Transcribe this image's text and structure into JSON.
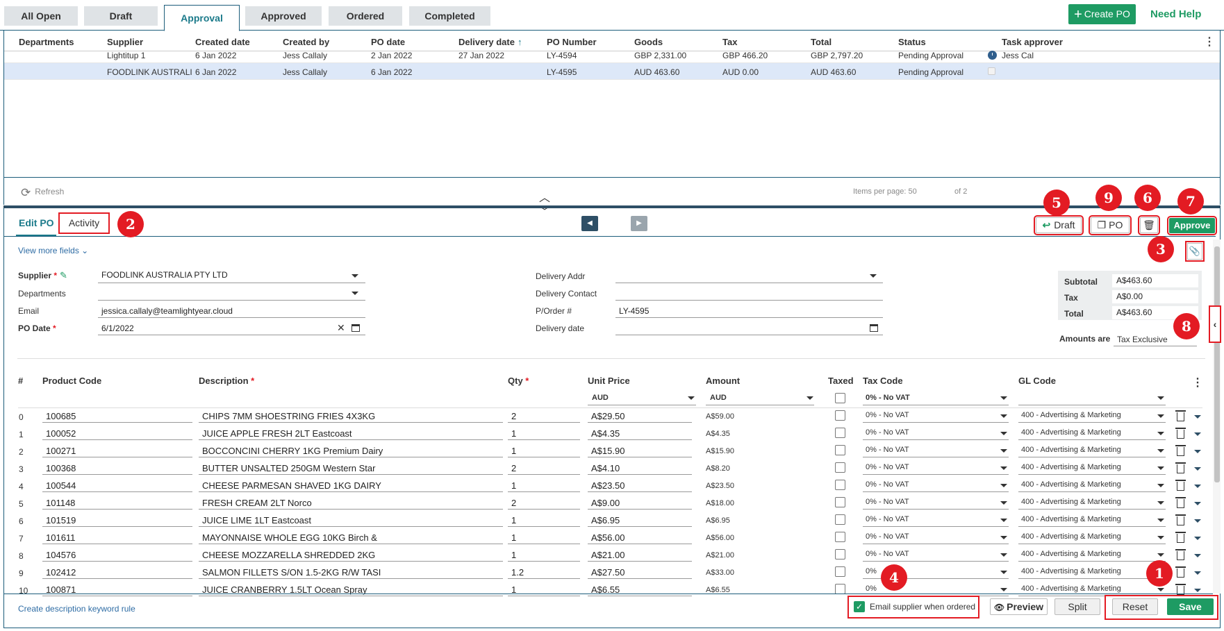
{
  "tabs": [
    "All Open",
    "Draft",
    "Approval",
    "Approved",
    "Ordered",
    "Completed"
  ],
  "header": {
    "create_po": "Create PO",
    "need_help": "Need Help"
  },
  "grid": {
    "columns": [
      "Departments",
      "Supplier",
      "Created date",
      "Created by",
      "PO date",
      "Delivery date",
      "PO Number",
      "Goods",
      "Tax",
      "Total",
      "Status",
      "Task approver"
    ],
    "sort_indicator": "↑",
    "rows": [
      {
        "department": "",
        "supplier": "Lightitup 1",
        "created": "6 Jan 2022",
        "created_by": "Jess Callaly",
        "po_date": "2 Jan 2022",
        "delivery": "27 Jan 2022",
        "po_number": "LY-4594",
        "goods": "GBP 2,331.00",
        "tax": "GBP 466.20",
        "total": "GBP 2,797.20",
        "status": "Pending Approval",
        "approver": "Jess Cal"
      },
      {
        "department": "",
        "supplier": "FOODLINK AUSTRALIA ...",
        "created": "6 Jan 2022",
        "created_by": "Jess Callaly",
        "po_date": "6 Jan 2022",
        "delivery": "",
        "po_number": "LY-4595",
        "goods": "AUD 463.60",
        "tax": "AUD 0.00",
        "total": "AUD 463.60",
        "status": "Pending Approval",
        "approver": ""
      }
    ],
    "refresh": "Refresh",
    "items_per_page": "Items per page: 50",
    "pager_text": "of 2"
  },
  "edit": {
    "tab_edit": "Edit PO",
    "tab_activity": "Activity",
    "btn_draft": "Draft",
    "btn_po": "PO",
    "btn_approve": "Approve",
    "view_more": "View more fields",
    "labels": {
      "supplier": "Supplier",
      "departments": "Departments",
      "email": "Email",
      "po_date": "PO Date",
      "delivery_addr": "Delivery Addr",
      "delivery_contact": "Delivery Contact",
      "porder": "P/Order #",
      "delivery_date": "Delivery date"
    },
    "values": {
      "supplier": "FOODLINK AUSTRALIA PTY LTD",
      "departments": "",
      "email": "jessica.callaly@teamlightyear.cloud",
      "po_date": "6/1/2022",
      "delivery_addr": "",
      "delivery_contact": "",
      "porder": "LY-4595",
      "delivery_date": ""
    },
    "totals": {
      "subtotal_label": "Subtotal",
      "subtotal": "A$463.60",
      "tax_label": "Tax",
      "tax": "A$0.00",
      "total_label": "Total",
      "total": "A$463.60",
      "amounts_label": "Amounts are",
      "amounts": "Tax Exclusive"
    }
  },
  "lines": {
    "columns": [
      "#",
      "Product Code",
      "Description",
      "Qty",
      "Unit Price",
      "Amount",
      "Taxed",
      "Tax Code",
      "GL Code"
    ],
    "unit_currency": "AUD",
    "amount_currency": "AUD",
    "default_tax": "0% - No VAT",
    "rows": [
      {
        "n": "0",
        "code": "100685",
        "desc": "CHIPS 7MM SHOESTRING FRIES 4X3KG",
        "qty": "2",
        "price": "A$29.50",
        "amount": "A$59.00",
        "tax": "0% - No VAT",
        "gl": "400 - Advertising & Marketing"
      },
      {
        "n": "1",
        "code": "100052",
        "desc": "JUICE APPLE FRESH 2LT Eastcoast",
        "qty": "1",
        "price": "A$4.35",
        "amount": "A$4.35",
        "tax": "0% - No VAT",
        "gl": "400 - Advertising & Marketing"
      },
      {
        "n": "2",
        "code": "100271",
        "desc": "BOCCONCINI CHERRY 1KG Premium Dairy",
        "qty": "1",
        "price": "A$15.90",
        "amount": "A$15.90",
        "tax": "0% - No VAT",
        "gl": "400 - Advertising & Marketing"
      },
      {
        "n": "3",
        "code": "100368",
        "desc": "BUTTER UNSALTED 250GM Western Star",
        "qty": "2",
        "price": "A$4.10",
        "amount": "A$8.20",
        "tax": "0% - No VAT",
        "gl": "400 - Advertising & Marketing"
      },
      {
        "n": "4",
        "code": "100544",
        "desc": "CHEESE PARMESAN SHAVED 1KG DAIRY",
        "qty": "1",
        "price": "A$23.50",
        "amount": "A$23.50",
        "tax": "0% - No VAT",
        "gl": "400 - Advertising & Marketing"
      },
      {
        "n": "5",
        "code": "101148",
        "desc": "FRESH CREAM 2LT Norco",
        "qty": "2",
        "price": "A$9.00",
        "amount": "A$18.00",
        "tax": "0% - No VAT",
        "gl": "400 - Advertising & Marketing"
      },
      {
        "n": "6",
        "code": "101519",
        "desc": "JUICE LIME 1LT Eastcoast",
        "qty": "1",
        "price": "A$6.95",
        "amount": "A$6.95",
        "tax": "0% - No VAT",
        "gl": "400 - Advertising & Marketing"
      },
      {
        "n": "7",
        "code": "101611",
        "desc": "MAYONNAISE WHOLE EGG 10KG Birch &",
        "qty": "1",
        "price": "A$56.00",
        "amount": "A$56.00",
        "tax": "0% - No VAT",
        "gl": "400 - Advertising & Marketing"
      },
      {
        "n": "8",
        "code": "104576",
        "desc": "CHEESE MOZZARELLA SHREDDED 2KG",
        "qty": "1",
        "price": "A$21.00",
        "amount": "A$21.00",
        "tax": "0% - No VAT",
        "gl": "400 - Advertising & Marketing"
      },
      {
        "n": "9",
        "code": "102412",
        "desc": "SALMON FILLETS S/ON 1.5-2KG R/W TASI",
        "qty": "1.2",
        "price": "A$27.50",
        "amount": "A$33.00",
        "tax": "0%",
        "gl": "400 - Advertising & Marketing"
      },
      {
        "n": "10",
        "code": "100871",
        "desc": "JUICE CRANBERRY 1.5LT Ocean Spray",
        "qty": "1",
        "price": "A$6.55",
        "amount": "A$6.55",
        "tax": "0%",
        "gl": "400 - Advertising & Marketing"
      }
    ]
  },
  "footer": {
    "keyword_rule": "Create description keyword rule",
    "email_supplier": "Email supplier when ordered",
    "preview": "Preview",
    "split": "Split",
    "reset": "Reset",
    "save": "Save"
  },
  "annotations": [
    "1",
    "2",
    "3",
    "4",
    "5",
    "6",
    "7",
    "8",
    "9"
  ],
  "colors": {
    "accent": "#1e9b63",
    "highlight": "#e31b23",
    "navy": "#1b5c7a",
    "selected_row": "#dde8f8"
  }
}
